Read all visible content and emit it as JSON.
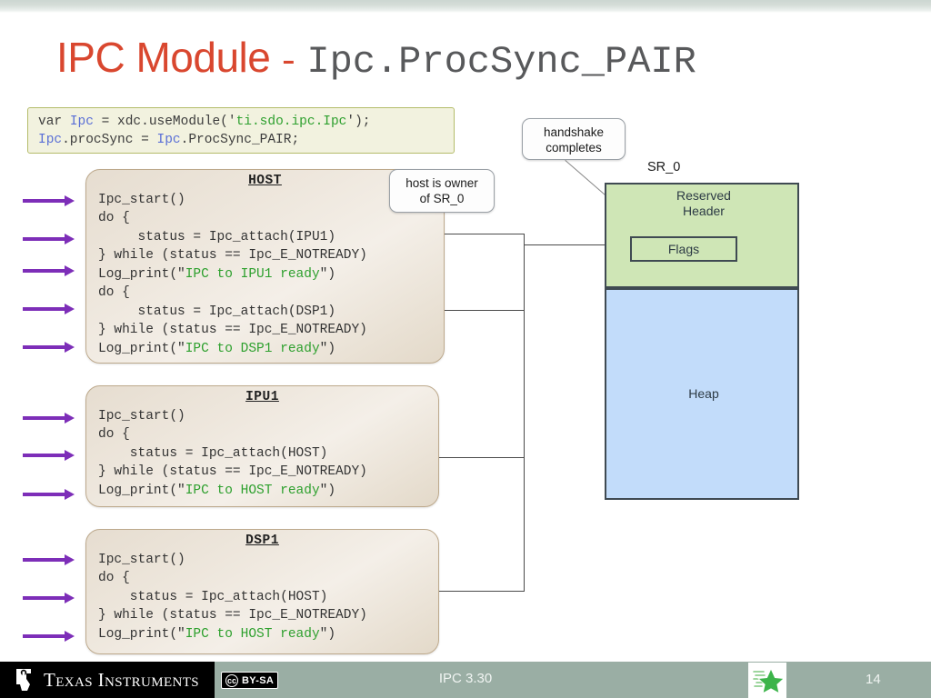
{
  "slide": {
    "title": {
      "main": "IPC Module",
      "dash": "-",
      "mono": "Ipc.ProcSync_PAIR"
    },
    "config_code": {
      "line1": {
        "a": "var ",
        "b": "Ipc",
        "c": " = xdc.useModule('",
        "d": "ti.sdo.ipc.Ipc",
        "e": "');"
      },
      "line2": {
        "a": "Ipc",
        "b": ".procSync = ",
        "c": "Ipc",
        "d": ".ProcSync_PAIR;"
      }
    },
    "cards": [
      {
        "id": "host",
        "title": "HOST",
        "lines": [
          "Ipc_start()",
          "do {",
          "     status = Ipc_attach(IPU1)",
          "} while (status == Ipc_E_NOTREADY)",
          "Log_print(\"IPC to IPU1 ready\")",
          "do {",
          "     status = Ipc_attach(DSP1)",
          "} while (status == Ipc_E_NOTREADY)",
          "Log_print(\"IPC to DSP1 ready\")"
        ],
        "strings": [
          "IPC to IPU1 ready",
          "IPC to DSP1 ready"
        ]
      },
      {
        "id": "ipu1",
        "title": "IPU1",
        "lines": [
          "Ipc_start()",
          "do {",
          "    status = Ipc_attach(HOST)",
          "} while (status == Ipc_E_NOTREADY)",
          "Log_print(\"IPC to HOST ready\")"
        ],
        "strings": [
          "IPC to HOST ready"
        ]
      },
      {
        "id": "dsp1",
        "title": "DSP1",
        "lines": [
          "Ipc_start()",
          "do {",
          "    status = Ipc_attach(HOST)",
          "} while (status == Ipc_E_NOTREADY)",
          "Log_print(\"IPC to HOST ready\")"
        ],
        "strings": [
          "IPC to HOST ready"
        ]
      }
    ],
    "callouts": {
      "handshake": "handshake\ncompletes",
      "handshake_line1": "handshake",
      "handshake_line2": "completes",
      "owner_line1": "host is owner",
      "owner_line2": "of SR_0"
    },
    "memory": {
      "sr_label": "SR_0",
      "header_line1": "Reserved",
      "header_line2": "Header",
      "flags": "Flags",
      "heap": "Heap",
      "header_color": "#cfe6b6",
      "heap_color": "#c2dcfa",
      "border_color": "#3f4a52"
    },
    "footer": {
      "company": "Texas Instruments",
      "license_mark": "cc",
      "license_text": "BY-SA",
      "center_text": "IPC 3.30",
      "page_number": "14"
    },
    "colors": {
      "title_accent": "#d9472f",
      "title_mono": "#58595b",
      "arrow_purple": "#7d2eb8",
      "code_string": "#2ea02e",
      "code_ident": "#5a6fd6",
      "footer_bg": "#9aaea4"
    }
  }
}
